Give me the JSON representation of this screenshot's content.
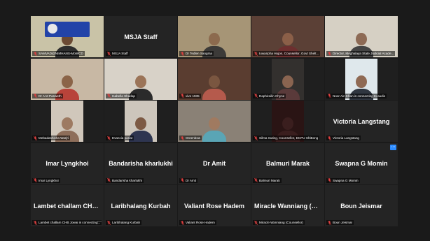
{
  "tiles": [
    {
      "name": "SAMVAD@NIMHANS-MoWCD",
      "big": "",
      "video": true,
      "bg": "#c9c3a7",
      "skin": "#6b4a34",
      "shirt": "#2e2e2e",
      "logo": true,
      "active": true
    },
    {
      "name": "MSJA Staff",
      "big": "MSJA Staff",
      "video": false
    },
    {
      "name": "Dr Tedlen Sangma",
      "big": "",
      "video": true,
      "bg": "#a69576",
      "skin": "#8c6a4e",
      "shirt": "#3c3a38"
    },
    {
      "name": "Iuwanpha Hujon, Counsellor, Govt Shelt...",
      "big": "",
      "video": true,
      "bg": "#5b4036",
      "skin": "#8b5f48",
      "shirt": "#6d2f2f"
    },
    {
      "name": "Director, Meghalaya State Judicial Acade...",
      "big": "",
      "video": true,
      "bg": "#d6d0c4",
      "skin": "#8d6a55",
      "shirt": "#444"
    },
    {
      "name": "Dr A M Pasweth",
      "big": "",
      "video": true,
      "bg": "#c8b8a4",
      "skin": "#8b6448",
      "shirt": "#b8433a"
    },
    {
      "name": "Isabella Shadap",
      "big": "",
      "video": true,
      "bg": "#d8d2c8",
      "skin": "#9b7458",
      "shirt": "#2b2b2b"
    },
    {
      "name": "vivo 1935",
      "big": "",
      "video": true,
      "bg": "#5a3d30",
      "skin": "#7a5640",
      "shirt": "#b55a4c"
    },
    {
      "name": "Daphirailin Chyne",
      "big": "",
      "video": true,
      "bg": "#33302e",
      "skin": "#8a6450",
      "shirt": "#5a3a3a",
      "narrow": true
    },
    {
      "name": "Noor Ain Khan is connecting to audio",
      "big": "",
      "video": true,
      "bg": "#dfe8ec",
      "skin": "#8f6a54",
      "shirt": "#2f3640",
      "narrow": true
    },
    {
      "name": "Mebadashisha Warjri",
      "big": "",
      "video": true,
      "bg": "#d0c7bb",
      "skin": "#9d7a62",
      "shirt": "#8e6e5a",
      "narrow": true
    },
    {
      "name": "Evancia pariat",
      "big": "",
      "video": true,
      "bg": "#cdc6bc",
      "skin": "#7d5a44",
      "shirt": "#2e3550",
      "narrow": true
    },
    {
      "name": "Greenbow",
      "big": "",
      "video": true,
      "bg": "#8a8176",
      "skin": "#a07a60",
      "shirt": "#5aa5b5"
    },
    {
      "name": "Silma Suting, Counsellor, DCPU ShiBong",
      "big": "",
      "video": true,
      "bg": "#2a1414",
      "skin": "#3a1e1e",
      "shirt": "#3a1e1e",
      "narrow": true
    },
    {
      "name": "Victoria Langstang",
      "big": "Victoria Langstang",
      "video": false
    },
    {
      "name": "Imar Lyngkhoi",
      "big": "Imar Lyngkhoi",
      "video": false
    },
    {
      "name": "Bandarisha kharlukhi",
      "big": "Bandarisha kharlukhi",
      "video": false
    },
    {
      "name": "Dr Amit",
      "big": "Dr Amit",
      "video": false
    },
    {
      "name": "Balmuri Marak",
      "big": "Balmuri Marak",
      "video": false
    },
    {
      "name": "Swapna G Momin",
      "big": "Swapna G Momin",
      "video": false,
      "pin": true
    },
    {
      "name": "Lambet challam CHB Jowai is connecting...",
      "big": "Lambet challam CHB Jowai",
      "video": false,
      "dots": true
    },
    {
      "name": "Laribhalang Kurbah",
      "big": "Laribhalang Kurbah",
      "video": false
    },
    {
      "name": "Valiant Rose Hadem",
      "big": "Valiant Rose Hadem",
      "video": false
    },
    {
      "name": "Miracle Wanniang (Counsellor)",
      "big": "Miracle Wanniang (Counse...",
      "video": false
    },
    {
      "name": "Boun Jeismar",
      "big": "Boun Jeismar",
      "video": false
    }
  ],
  "colors": {
    "mic_muted": "#e04040",
    "active_border": "#b7e36a",
    "tile_bg": "#242424"
  }
}
